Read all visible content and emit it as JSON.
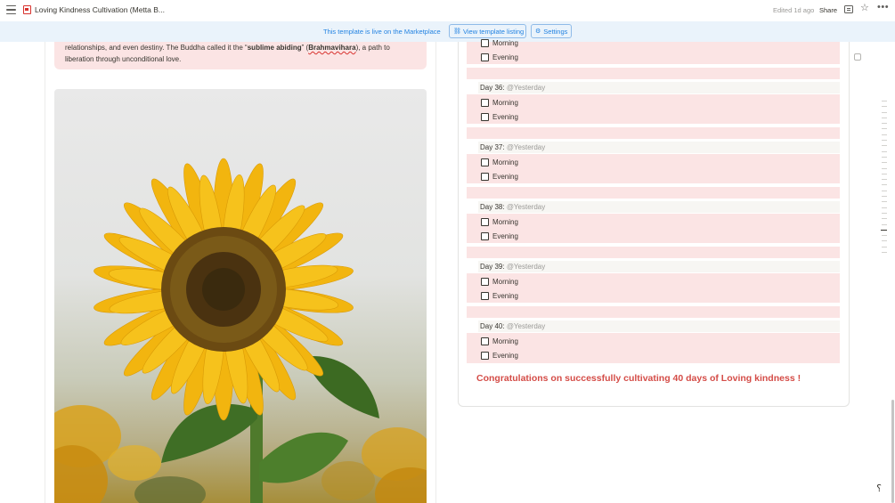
{
  "header": {
    "title": "Loving Kindness Cultivation (Metta B...",
    "edited": "Edited 1d ago",
    "share": "Share"
  },
  "banner": {
    "text": "This template is live on the Marketplace",
    "listing_button": "View template listing",
    "settings_button": "Settings"
  },
  "quote": {
    "line1_before": "relationships, and even destiny. The Buddha called it the “",
    "bold1": "sublime abiding",
    "mid": "” (",
    "bold2": "Brahmavihara",
    "line1_after": "), a path to",
    "line2": "liberation through unconditional love."
  },
  "tracker": {
    "top_partial_morning": "Morning",
    "top_partial_evening": "Evening",
    "days": [
      {
        "label": "Day 36:",
        "date": "@Yesterday",
        "morning": "Morning",
        "evening": "Evening"
      },
      {
        "label": "Day 37:",
        "date": "@Yesterday",
        "morning": "Morning",
        "evening": "Evening"
      },
      {
        "label": "Day 38:",
        "date": "@Yesterday",
        "morning": "Morning",
        "evening": "Evening"
      },
      {
        "label": "Day 39:",
        "date": "@Yesterday",
        "morning": "Morning",
        "evening": "Evening"
      },
      {
        "label": "Day 40:",
        "date": "@Yesterday",
        "morning": "Morning",
        "evening": "Evening"
      }
    ],
    "congrats": "Congratulations on successfully cultivating 40 days of Loving kindness !"
  },
  "colors": {
    "accent_blue": "#2383e2",
    "callout_pink": "#fbe4e4",
    "congrats_red": "#d44c47"
  },
  "icons": {
    "menu": "menu-icon",
    "page": "page-icon",
    "comment": "comment-icon",
    "star": "star-icon",
    "more": "more-icon",
    "help": "help-icon"
  }
}
